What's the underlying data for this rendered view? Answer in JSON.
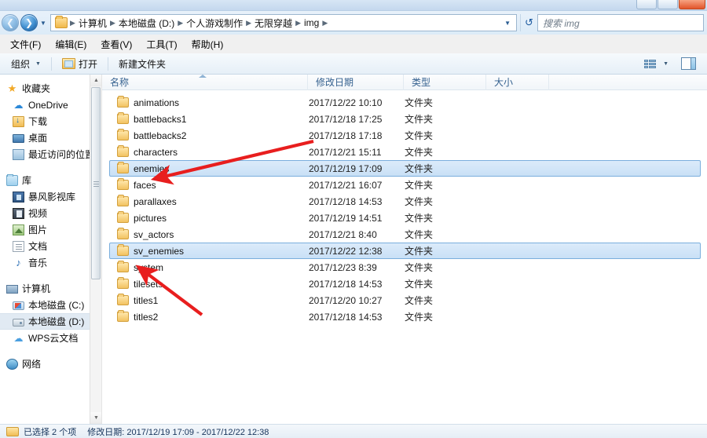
{
  "window": {
    "buttons": [
      "minimize",
      "maximize",
      "close"
    ]
  },
  "address": {
    "back_icon": "back-arrow-icon",
    "forward_icon": "forward-arrow-icon",
    "history_caret": "chevron-down-icon",
    "folder_icon": "folder-icon",
    "breadcrumbs": [
      "计算机",
      "本地磁盘 (D:)",
      "个人游戏制作",
      "无限穿越",
      "img"
    ],
    "dropdown_caret": "chevron-down-icon",
    "refresh_icon": "refresh-icon",
    "search_placeholder": "搜索 img"
  },
  "menu": {
    "items": [
      "文件(F)",
      "编辑(E)",
      "查看(V)",
      "工具(T)",
      "帮助(H)"
    ]
  },
  "toolbar": {
    "organize_label": "组织",
    "organize_caret": "chevron-down-icon",
    "open_label": "打开",
    "open_icon": "open-folder-icon",
    "newfolder_label": "新建文件夹",
    "views_icon": "view-options-icon",
    "views_caret": "chevron-down-icon",
    "preview_icon": "preview-pane-icon"
  },
  "sidebar": {
    "groups": [
      {
        "header": {
          "label": "收藏夹",
          "icon": "star-icon"
        },
        "items": [
          {
            "label": "OneDrive",
            "icon": "cloud-icon"
          },
          {
            "label": "下载",
            "icon": "downloads-icon"
          },
          {
            "label": "桌面",
            "icon": "desktop-icon"
          },
          {
            "label": "最近访问的位置",
            "icon": "recent-places-icon"
          }
        ]
      },
      {
        "header": {
          "label": "库",
          "icon": "library-icon"
        },
        "items": [
          {
            "label": "暴风影视库",
            "icon": "baofeng-video-icon"
          },
          {
            "label": "视频",
            "icon": "video-icon"
          },
          {
            "label": "图片",
            "icon": "pictures-icon"
          },
          {
            "label": "文档",
            "icon": "documents-icon"
          },
          {
            "label": "音乐",
            "icon": "music-icon"
          }
        ]
      },
      {
        "header": {
          "label": "计算机",
          "icon": "computer-icon"
        },
        "items": [
          {
            "label": "本地磁盘 (C:)",
            "icon": "windows-drive-icon",
            "selected": false
          },
          {
            "label": "本地磁盘 (D:)",
            "icon": "drive-icon",
            "selected": true
          },
          {
            "label": "WPS云文档",
            "icon": "wps-cloud-icon",
            "selected": false
          }
        ]
      },
      {
        "header": {
          "label": "网络",
          "icon": "network-icon"
        },
        "items": []
      }
    ],
    "scroll": {
      "up_icon": "scroll-up-icon",
      "down_icon": "scroll-down-icon"
    }
  },
  "filelist": {
    "columns": [
      {
        "label": "名称",
        "sorted": true
      },
      {
        "label": "修改日期",
        "sorted": false
      },
      {
        "label": "类型",
        "sorted": false
      },
      {
        "label": "大小",
        "sorted": false
      }
    ],
    "rows": [
      {
        "name": "animations",
        "date": "2017/12/22 10:10",
        "type": "文件夹",
        "size": "",
        "selected": false
      },
      {
        "name": "battlebacks1",
        "date": "2017/12/18 17:25",
        "type": "文件夹",
        "size": "",
        "selected": false
      },
      {
        "name": "battlebacks2",
        "date": "2017/12/18 17:18",
        "type": "文件夹",
        "size": "",
        "selected": false
      },
      {
        "name": "characters",
        "date": "2017/12/21 15:11",
        "type": "文件夹",
        "size": "",
        "selected": false
      },
      {
        "name": "enemies",
        "date": "2017/12/19 17:09",
        "type": "文件夹",
        "size": "",
        "selected": true
      },
      {
        "name": "faces",
        "date": "2017/12/21 16:07",
        "type": "文件夹",
        "size": "",
        "selected": false
      },
      {
        "name": "parallaxes",
        "date": "2017/12/18 14:53",
        "type": "文件夹",
        "size": "",
        "selected": false
      },
      {
        "name": "pictures",
        "date": "2017/12/19 14:51",
        "type": "文件夹",
        "size": "",
        "selected": false
      },
      {
        "name": "sv_actors",
        "date": "2017/12/21 8:40",
        "type": "文件夹",
        "size": "",
        "selected": false
      },
      {
        "name": "sv_enemies",
        "date": "2017/12/22 12:38",
        "type": "文件夹",
        "size": "",
        "selected": true
      },
      {
        "name": "system",
        "date": "2017/12/23 8:39",
        "type": "文件夹",
        "size": "",
        "selected": false
      },
      {
        "name": "tilesets",
        "date": "2017/12/18 14:53",
        "type": "文件夹",
        "size": "",
        "selected": false
      },
      {
        "name": "titles1",
        "date": "2017/12/20 10:27",
        "type": "文件夹",
        "size": "",
        "selected": false
      },
      {
        "name": "titles2",
        "date": "2017/12/18 14:53",
        "type": "文件夹",
        "size": "",
        "selected": false
      }
    ]
  },
  "status": {
    "selection": "已选择 2 个项",
    "detail": "修改日期: 2017/12/19 17:09 - 2017/12/22 12:38",
    "icon": "folder-icon"
  },
  "annotations": {
    "color": "#e81e1e",
    "arrows": [
      {
        "name": "arrow-to-enemies",
        "target": "enemies"
      },
      {
        "name": "arrow-to-sv-enemies",
        "target": "sv_enemies"
      }
    ]
  },
  "colors": {
    "accent": "#2a5d92",
    "selection": "#c9e0f6",
    "annotation_red": "#e81e1e",
    "folder_yellow": "#f2c260"
  }
}
